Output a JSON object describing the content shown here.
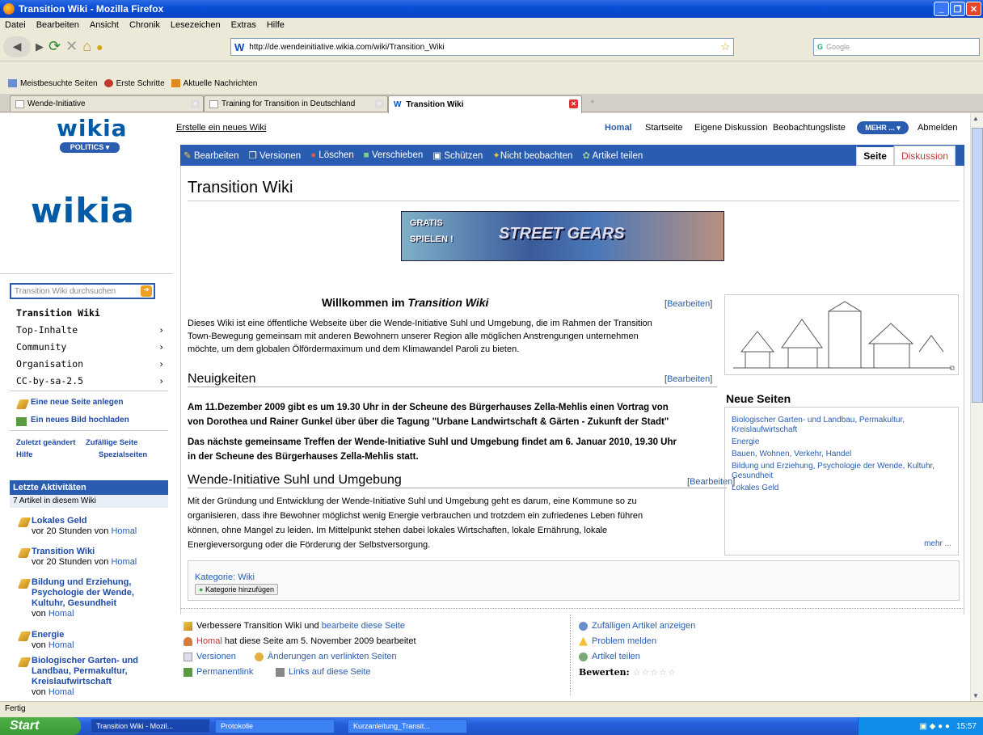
{
  "window": {
    "title": "Transition Wiki - Mozilla Firefox"
  },
  "menubar": [
    "Datei",
    "Bearbeiten",
    "Ansicht",
    "Chronik",
    "Lesezeichen",
    "Extras",
    "Hilfe"
  ],
  "navbar": {
    "url": "http://de.wendeinitiative.wikia.com/wiki/Transition_Wiki",
    "search_placeholder": "Google"
  },
  "bookmarks": [
    "Meistbesuchte Seiten",
    "Erste Schritte",
    "Aktuelle Nachrichten"
  ],
  "tabs": [
    "Wende-Initiative",
    "Training for Transition in Deutschland",
    "Transition Wiki"
  ],
  "sidebar": {
    "logo_small": "wikia",
    "badge": "POLITICS",
    "logo_big": "wikia",
    "search_placeholder": "Transition Wiki durchsuchen",
    "items": [
      "Transition Wiki",
      "Top-Inhalte",
      "Community",
      "Organisation",
      "CC-by-sa-2.5"
    ],
    "action1": "Eine neue Seite anlegen",
    "action2": "Ein neues Bild hochladen",
    "links": [
      "Zuletzt geändert",
      "Zufällige Seite",
      "Hilfe",
      "Spezialseiten"
    ],
    "activity_title": "Letzte Aktivitäten",
    "activity_count": "7 Artikel in diesem Wiki",
    "activities": [
      {
        "title": "Lokales Geld",
        "meta": "vor 20 Stunden von",
        "user": "Homal"
      },
      {
        "title": "Transition Wiki",
        "meta": "vor 20 Stunden von",
        "user": "Homal"
      },
      {
        "title": "Bildung und Erziehung, Psychologie der Wende, Kultuhr, Gesundheit",
        "meta": "von",
        "user": "Homal"
      },
      {
        "title": "Energie",
        "meta": "von",
        "user": "Homal"
      },
      {
        "title": "Biologischer Garten- und Landbau, Permakultur, Kreislaufwirtschaft",
        "meta": "von",
        "user": "Homal"
      }
    ]
  },
  "topnav": {
    "create": "Erstelle ein neues Wiki",
    "user": "Homal",
    "links": [
      "Startseite",
      "Eigene Diskussion",
      "Beobachtungsliste"
    ],
    "more": "MEHR ...",
    "logout": "Abmelden"
  },
  "toolbar": [
    "Bearbeiten",
    "Versionen",
    "Löschen",
    "Verschieben",
    "Schützen",
    "Nicht beobachten",
    "Artikel teilen"
  ],
  "pagetabs": [
    "Seite",
    "Diskussion"
  ],
  "article": {
    "title": "Transition Wiki",
    "banner_text": [
      "GRATIS",
      "SPIELEN !",
      "STREET GEARS"
    ],
    "welcome_prefix": "Willkommen im ",
    "welcome_em": "Transition Wiki",
    "edit_label": "[Bearbeiten]",
    "intro": [
      "Dieses Wiki ist eine öffentliche Webseite über die Wende-Initiative Suhl und Umgebung, die im Rahmen der Transition",
      "Town-Bewegung gemeinsam mit anderen Bewohnern unserer Region alle möglichen Anstrengungen unternehmen",
      "möchte, um dem globalen Ölfördermaximum und dem Klimawandel Paroli zu bieten."
    ],
    "news_head": "Neuigkeiten",
    "news1": [
      "Am 11.Dezember 2009 gibt es um 19.30 Uhr in der Scheune des Bürgerhauses Zella-Mehlis einen Vortrag von",
      "von Dorothea und Rainer Gunkel über über die Tagung \"Urbane Landwirtschaft & Gärten - Zukunft der Stadt\""
    ],
    "news2": [
      "Das nächste gemeinsame Treffen der Wende-Initiative Suhl und Umgebung findet am 6. Januar 2010, 19.30 Uhr",
      "in der Scheune des Bürgerhauses Zella-Mehlis statt."
    ],
    "wende_head": "Wende-Initiative Suhl und Umgebung",
    "wende": [
      "Mit der Gründung und Entwicklung der Wende-Initiative Suhl und Umgebung geht es darum, eine Kommune so zu",
      "organisieren, dass ihre Bewohner möglichst wenig Energie verbrauchen und trotzdem ein zufriedenes Leben führen",
      "können, ohne Mangel zu leiden. Im Mittelpunkt stehen dabei lokales Wirtschaften, lokale Ernährung, lokale",
      "Energieversorgung oder die Förderung der Selbstversorgung."
    ]
  },
  "neue_seiten": {
    "title": "Neue Seiten",
    "items": [
      "Biologischer Garten- und Landbau, Permakultur, Kreislaufwirtschaft",
      "Energie",
      "Bauen, Wohnen, Verkehr, Handel",
      "Bildung und Erziehung, Psychologie der Wende, Kultuhr, Gesundheit",
      "Lokales Geld"
    ],
    "more": "mehr ..."
  },
  "category": {
    "label": "Kategorie: Wiki",
    "add": "Kategorie hinzufügen"
  },
  "footer": {
    "improve_prefix": "Verbessere Transition Wiki und ",
    "improve_link": "bearbeite diese Seite",
    "edited_user": "Homal",
    "edited_text": " hat diese Seite am 5. November 2009 bearbeitet",
    "versions": "Versionen",
    "changes": "Änderungen an verlinkten Seiten",
    "permalink": "Permanentlink",
    "links_here": "Links auf diese Seite",
    "random": "Zufälligen Artikel anzeigen",
    "problem": "Problem melden",
    "share": "Artikel teilen",
    "rate": "Bewerten:"
  },
  "statusbar": "Fertig",
  "taskbar": {
    "start": "Start",
    "tasks": [
      "Transition Wiki - Mozil...",
      "Protokolle",
      "Kurzanleitung_Transit..."
    ],
    "clock": "15:57"
  }
}
